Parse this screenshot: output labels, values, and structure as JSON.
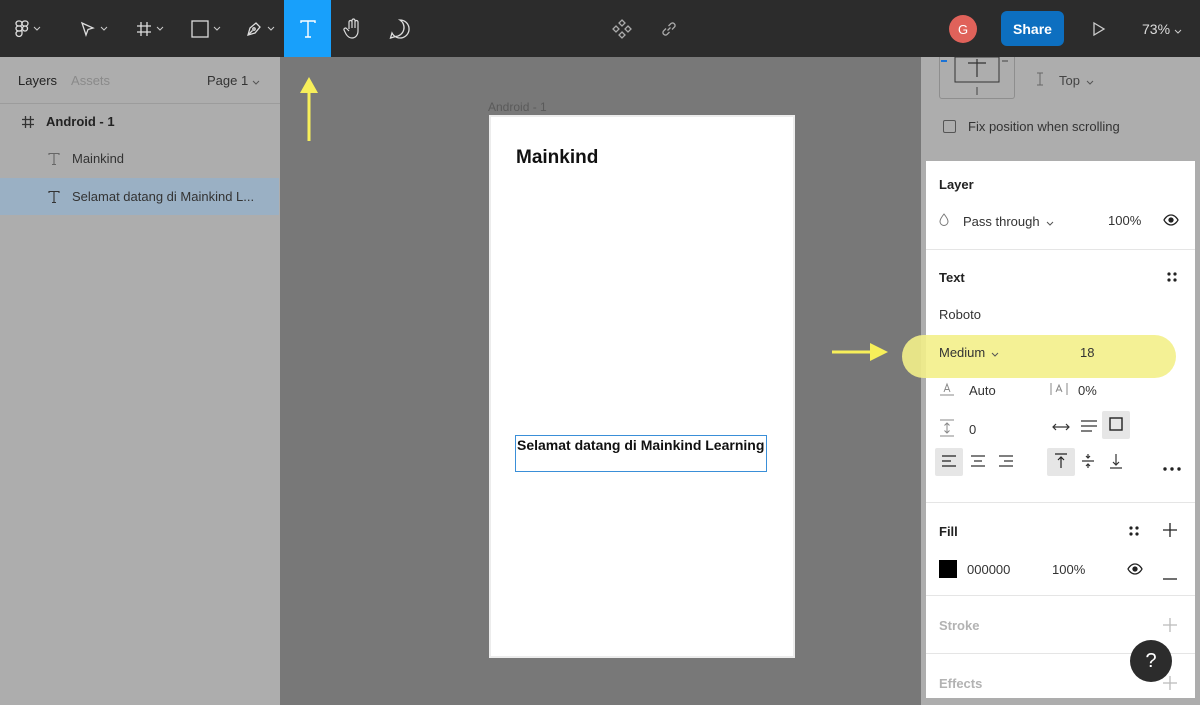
{
  "toolbar": {
    "share_label": "Share",
    "avatar_initial": "G",
    "zoom": "73%",
    "active_tool": "text",
    "colors": {
      "bg": "#2c2c2c",
      "active_tool": "#18a0fb",
      "share": "#0d6fc0",
      "avatar": "#e0625a"
    }
  },
  "left_panel": {
    "tabs": [
      {
        "label": "Layers"
      },
      {
        "label": "Assets"
      }
    ],
    "page": "Page 1",
    "layers": [
      {
        "label": "Android - 1",
        "icon": "frame-icon"
      },
      {
        "label": "Mainkind",
        "icon": "text-icon"
      },
      {
        "label": "Selamat datang di Mainkind L...",
        "icon": "text-icon"
      }
    ]
  },
  "canvas": {
    "frame_label": "Android - 1",
    "title_text": "Mainkind",
    "body_text": "Selamat datang di Mainkind Learning"
  },
  "right_panel": {
    "vertical_constraint": "Top",
    "fix_position_label": "Fix position when scrolling",
    "layer": {
      "title": "Layer",
      "blend": "Pass through",
      "opacity": "100%"
    },
    "text": {
      "title": "Text",
      "font_family": "Roboto",
      "font_weight": "Medium",
      "font_size": "18",
      "line_height": "Auto",
      "letter_spacing": "0%",
      "paragraph_spacing": "0"
    },
    "fill": {
      "title": "Fill",
      "color": "000000",
      "opacity": "100%"
    },
    "stroke": {
      "title": "Stroke"
    },
    "effects": {
      "title": "Effects"
    }
  },
  "help_label": "?"
}
